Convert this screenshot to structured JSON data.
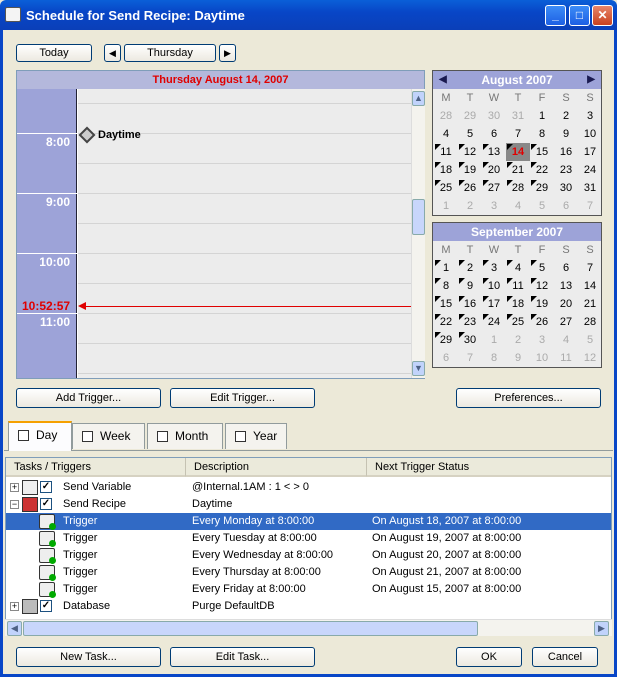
{
  "window": {
    "title": "Schedule for Send Recipe: Daytime",
    "min": "_",
    "max": "□",
    "close": "✕"
  },
  "nav": {
    "today_label": "Today",
    "prev_label": "◀",
    "day_label": "Thursday",
    "next_label": "▶"
  },
  "schedule": {
    "date_header": "Thursday August 14, 2007",
    "times": [
      "8:00",
      "9:00",
      "10:00",
      "11:00"
    ],
    "current_time": "10:52:57",
    "event_label": "Daytime"
  },
  "calendar_aug": {
    "title": "August 2007",
    "dow": [
      "M",
      "T",
      "W",
      "T",
      "F",
      "S",
      "S"
    ],
    "days": [
      {
        "d": "28",
        "m": true
      },
      {
        "d": "29",
        "m": true
      },
      {
        "d": "30",
        "m": true
      },
      {
        "d": "31",
        "m": true
      },
      {
        "d": "1"
      },
      {
        "d": "2"
      },
      {
        "d": "3"
      },
      {
        "d": "4"
      },
      {
        "d": "5"
      },
      {
        "d": "6"
      },
      {
        "d": "7"
      },
      {
        "d": "8"
      },
      {
        "d": "9"
      },
      {
        "d": "10"
      },
      {
        "d": "11",
        "k": true
      },
      {
        "d": "12",
        "k": true
      },
      {
        "d": "13",
        "k": true
      },
      {
        "d": "14",
        "k": true,
        "t": true
      },
      {
        "d": "15",
        "k": true
      },
      {
        "d": "16"
      },
      {
        "d": "17"
      },
      {
        "d": "18",
        "k": true
      },
      {
        "d": "19",
        "k": true
      },
      {
        "d": "20",
        "k": true
      },
      {
        "d": "21",
        "k": true
      },
      {
        "d": "22",
        "k": true
      },
      {
        "d": "23"
      },
      {
        "d": "24"
      },
      {
        "d": "25",
        "k": true
      },
      {
        "d": "26",
        "k": true
      },
      {
        "d": "27",
        "k": true
      },
      {
        "d": "28",
        "k": true
      },
      {
        "d": "29",
        "k": true
      },
      {
        "d": "30"
      },
      {
        "d": "31"
      },
      {
        "d": "1",
        "m": true
      },
      {
        "d": "2",
        "m": true
      },
      {
        "d": "3",
        "m": true
      },
      {
        "d": "4",
        "m": true
      },
      {
        "d": "5",
        "m": true
      },
      {
        "d": "6",
        "m": true
      },
      {
        "d": "7",
        "m": true
      }
    ]
  },
  "calendar_sep": {
    "title": "September 2007",
    "dow": [
      "M",
      "T",
      "W",
      "T",
      "F",
      "S",
      "S"
    ],
    "days": [
      {
        "d": "1",
        "k": true
      },
      {
        "d": "2",
        "k": true
      },
      {
        "d": "3",
        "k": true
      },
      {
        "d": "4",
        "k": true
      },
      {
        "d": "5",
        "k": true
      },
      {
        "d": "6"
      },
      {
        "d": "7"
      },
      {
        "d": "8",
        "k": true
      },
      {
        "d": "9",
        "k": true
      },
      {
        "d": "10",
        "k": true
      },
      {
        "d": "11",
        "k": true
      },
      {
        "d": "12",
        "k": true
      },
      {
        "d": "13"
      },
      {
        "d": "14"
      },
      {
        "d": "15",
        "k": true
      },
      {
        "d": "16",
        "k": true
      },
      {
        "d": "17",
        "k": true
      },
      {
        "d": "18",
        "k": true
      },
      {
        "d": "19",
        "k": true
      },
      {
        "d": "20"
      },
      {
        "d": "21"
      },
      {
        "d": "22",
        "k": true
      },
      {
        "d": "23",
        "k": true
      },
      {
        "d": "24",
        "k": true
      },
      {
        "d": "25",
        "k": true
      },
      {
        "d": "26",
        "k": true
      },
      {
        "d": "27"
      },
      {
        "d": "28"
      },
      {
        "d": "29",
        "k": true
      },
      {
        "d": "30",
        "k": true
      },
      {
        "d": "1",
        "m": true
      },
      {
        "d": "2",
        "m": true
      },
      {
        "d": "3",
        "m": true
      },
      {
        "d": "4",
        "m": true
      },
      {
        "d": "5",
        "m": true
      },
      {
        "d": "6",
        "m": true
      },
      {
        "d": "7",
        "m": true
      },
      {
        "d": "8",
        "m": true
      },
      {
        "d": "9",
        "m": true
      },
      {
        "d": "10",
        "m": true
      },
      {
        "d": "11",
        "m": true
      },
      {
        "d": "12",
        "m": true
      }
    ]
  },
  "buttons": {
    "add_trigger": "Add Trigger...",
    "edit_trigger": "Edit Trigger...",
    "preferences": "Preferences...",
    "new_task": "New Task...",
    "edit_task": "Edit Task...",
    "ok": "OK",
    "cancel": "Cancel"
  },
  "tabs": [
    "Day",
    "Week",
    "Month",
    "Year"
  ],
  "tree": {
    "columns": [
      "Tasks / Triggers",
      "Description",
      "Next Trigger Status"
    ],
    "rows": [
      {
        "name": "Send Variable",
        "desc": "@Internal.1AM :  1 < > 0",
        "next": "",
        "level": 0,
        "exp": "+",
        "icon": "variable-icon"
      },
      {
        "name": "Send Recipe",
        "desc": "Daytime",
        "next": "",
        "level": 0,
        "exp": "−",
        "icon": "recipe-icon"
      },
      {
        "name": "Trigger",
        "desc": "Every Monday at 8:00:00",
        "next": "On August 18, 2007 at 8:00:00",
        "level": 1,
        "sel": true,
        "icon": "trigger-icon"
      },
      {
        "name": "Trigger",
        "desc": "Every Tuesday at 8:00:00",
        "next": "On August 19, 2007 at 8:00:00",
        "level": 1,
        "icon": "trigger-icon"
      },
      {
        "name": "Trigger",
        "desc": "Every Wednesday at 8:00:00",
        "next": "On August 20, 2007 at 8:00:00",
        "level": 1,
        "icon": "trigger-icon"
      },
      {
        "name": "Trigger",
        "desc": "Every Thursday at 8:00:00",
        "next": "On August 21, 2007 at 8:00:00",
        "level": 1,
        "icon": "trigger-icon"
      },
      {
        "name": "Trigger",
        "desc": "Every Friday at 8:00:00",
        "next": "On August 15, 2007 at 8:00:00",
        "level": 1,
        "icon": "trigger-icon"
      },
      {
        "name": "Database",
        "desc": "Purge DefaultDB",
        "next": "",
        "level": 0,
        "exp": "+",
        "icon": "database-icon"
      }
    ]
  },
  "colors": {
    "title_bar": "#0846c7",
    "time_column": "#9da3d8",
    "date_header_text": "#e00000",
    "selection": "#316ac5"
  }
}
